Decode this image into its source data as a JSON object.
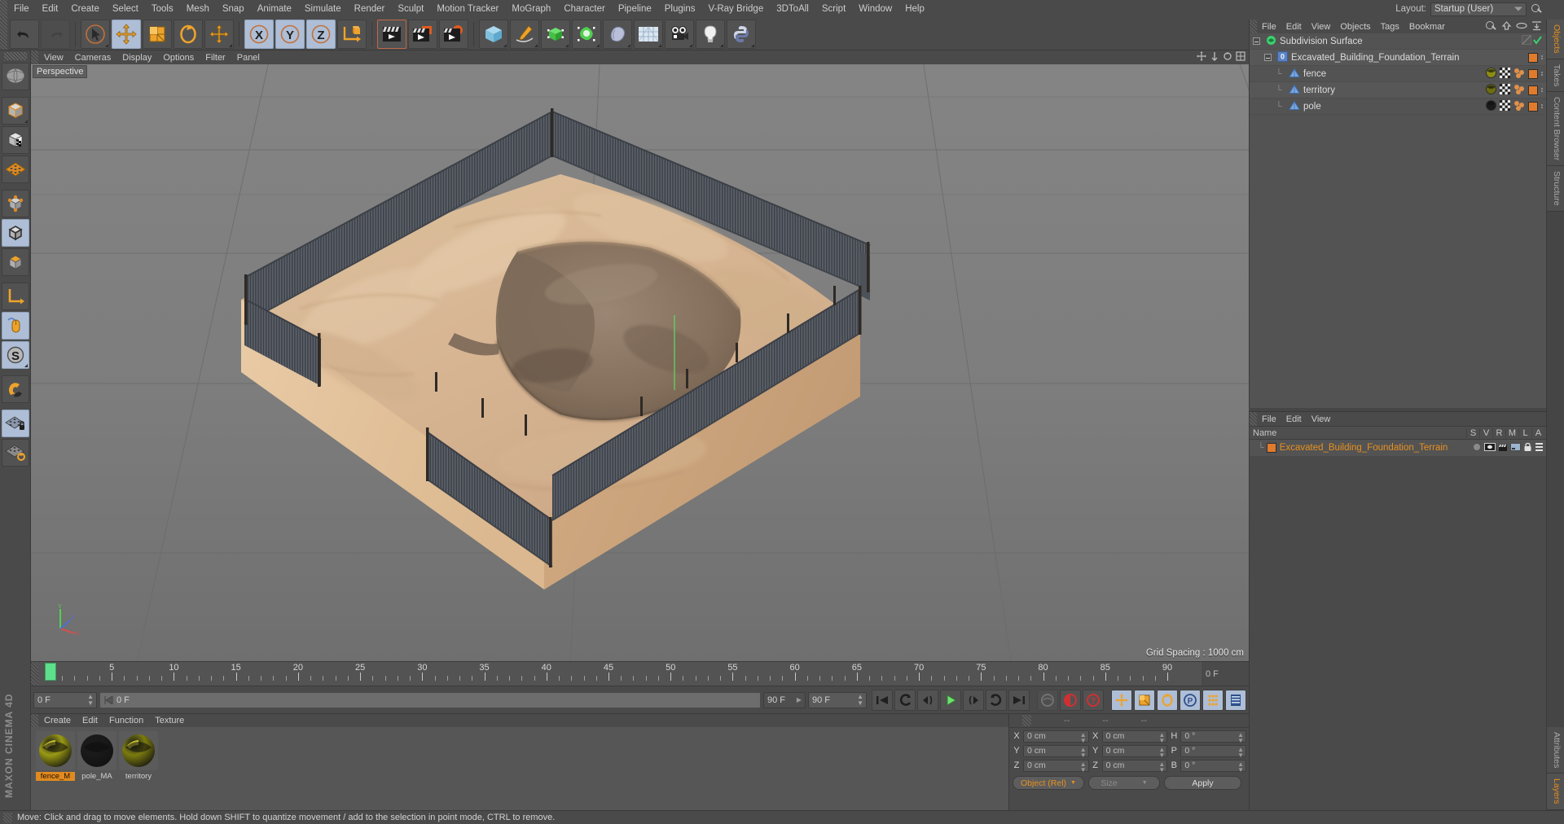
{
  "app": {
    "brand": "MAXON CINEMA 4D"
  },
  "menubar": {
    "items": [
      "File",
      "Edit",
      "Create",
      "Select",
      "Tools",
      "Mesh",
      "Snap",
      "Animate",
      "Simulate",
      "Render",
      "Sculpt",
      "Motion Tracker",
      "MoGraph",
      "Character",
      "Pipeline",
      "Plugins",
      "V-Ray Bridge",
      "3DToAll",
      "Script",
      "Window",
      "Help"
    ],
    "layout_label": "Layout:",
    "layout_value": "Startup (User)",
    "search_icon": "search-icon"
  },
  "toolbar": {
    "groups": [
      {
        "name": "history",
        "buttons": [
          {
            "icon": "undo-icon",
            "state": "normal"
          },
          {
            "icon": "redo-icon",
            "state": "disabled"
          }
        ]
      },
      {
        "name": "tools",
        "buttons": [
          {
            "icon": "select-live-icon",
            "state": "normal"
          },
          {
            "icon": "move-icon",
            "state": "active"
          },
          {
            "icon": "scale-icon",
            "state": "normal"
          },
          {
            "icon": "rotate-icon",
            "state": "normal"
          },
          {
            "icon": "move-dup-icon",
            "state": "normal"
          }
        ]
      },
      {
        "name": "axes",
        "buttons": [
          {
            "icon": "axis-x-icon",
            "state": "active"
          },
          {
            "icon": "axis-y-icon",
            "state": "active"
          },
          {
            "icon": "axis-z-icon",
            "state": "active"
          },
          {
            "icon": "world-object-axis-icon",
            "state": "normal"
          }
        ]
      },
      {
        "name": "render",
        "buttons": [
          {
            "icon": "render-view-icon",
            "state": "selected"
          },
          {
            "icon": "render-region-icon",
            "state": "normal"
          },
          {
            "icon": "render-settings-icon",
            "state": "normal"
          }
        ]
      },
      {
        "name": "objects",
        "buttons": [
          {
            "icon": "cube-primitive-icon",
            "state": "normal"
          },
          {
            "icon": "spline-pen-icon",
            "state": "normal"
          },
          {
            "icon": "generator-icon",
            "state": "normal"
          },
          {
            "icon": "deformer-icon",
            "state": "normal"
          },
          {
            "icon": "scene-environment-icon",
            "state": "normal"
          },
          {
            "icon": "floor-grid-icon",
            "state": "normal"
          },
          {
            "icon": "camera-icon",
            "state": "normal"
          },
          {
            "icon": "light-icon",
            "state": "normal"
          },
          {
            "icon": "python-icon",
            "state": "normal"
          }
        ]
      }
    ]
  },
  "lefttool": {
    "buttons": [
      {
        "icon": "texture-mode-icon",
        "state": "normal"
      },
      {
        "icon": "model-mode-icon",
        "state": "normal"
      },
      {
        "icon": "texture-axis-icon",
        "state": "normal"
      },
      {
        "icon": "workplane-icon",
        "state": "normal"
      },
      {
        "icon": "point-mode-icon",
        "state": "normal"
      },
      {
        "icon": "edge-mode-icon",
        "state": "active"
      },
      {
        "icon": "polygon-mode-icon",
        "state": "normal"
      },
      {
        "icon": "axis-modify-icon",
        "state": "normal"
      },
      {
        "icon": "viewport-solo-icon",
        "state": "active"
      },
      {
        "icon": "enable-axis-s-icon",
        "state": "active"
      },
      {
        "icon": "magnet-icon",
        "state": "normal"
      },
      {
        "icon": "workplane-lock-icon",
        "state": "active"
      },
      {
        "icon": "workplane-rotate-icon",
        "state": "normal"
      }
    ]
  },
  "viewport": {
    "menu": [
      "View",
      "Cameras",
      "Display",
      "Options",
      "Filter",
      "Panel"
    ],
    "label": "Perspective",
    "grid_spacing": "Grid Spacing : 1000 cm",
    "background_color": "#7a7a7a",
    "grid_line_color": "#6b6b6b",
    "terrain_top_color": "#d6b48d",
    "terrain_side_color": "#e3c19b",
    "pit_color": "#8d7a67",
    "fence_color": "#5b5e63",
    "axis_y_color": "#4fd24f",
    "axis_x_color": "#d24f4f",
    "axis_z_color": "#4f6fd2"
  },
  "timeline": {
    "ticks": [
      0,
      5,
      10,
      15,
      20,
      25,
      30,
      35,
      40,
      45,
      50,
      55,
      60,
      65,
      70,
      75,
      80,
      85,
      90
    ],
    "range_start": 0,
    "range_end": 90,
    "playhead_frame": 0,
    "end_value": "0 F"
  },
  "transport": {
    "current_frame": "0 F",
    "slider_value": "0 F",
    "range_end_small": "90 F",
    "range_end": "90 F",
    "buttons": [
      {
        "icon": "goto-start-icon"
      },
      {
        "icon": "prev-key-icon"
      },
      {
        "icon": "step-back-icon"
      },
      {
        "icon": "play-icon"
      },
      {
        "icon": "step-forward-icon"
      },
      {
        "icon": "next-key-icon"
      },
      {
        "icon": "goto-end-icon"
      }
    ],
    "buttons2": [
      {
        "icon": "record-tracks-icon"
      },
      {
        "icon": "record-active-icon"
      },
      {
        "icon": "autokey-icon"
      }
    ],
    "buttons3": [
      {
        "icon": "key-position-icon"
      },
      {
        "icon": "key-scale-icon"
      },
      {
        "icon": "key-rotation-icon"
      },
      {
        "icon": "key-param-icon"
      },
      {
        "icon": "key-pla-icon"
      },
      {
        "icon": "timeline-icon"
      }
    ]
  },
  "material_manager": {
    "menu": [
      "Create",
      "Edit",
      "Function",
      "Texture"
    ],
    "materials": [
      {
        "name": "fence_M",
        "selected": true,
        "color": "#9a9a14"
      },
      {
        "name": "pole_MA",
        "selected": false,
        "color": "#1a1a1a"
      },
      {
        "name": "territory",
        "selected": false,
        "color": "#7b7b10"
      }
    ]
  },
  "coordinates": {
    "headers": [
      "--",
      "--",
      "--"
    ],
    "position": {
      "label_x": "X",
      "label_y": "Y",
      "label_z": "Z",
      "x": "0 cm",
      "y": "0 cm",
      "z": "0 cm"
    },
    "size": {
      "label_x": "X",
      "label_y": "Y",
      "label_z": "Z",
      "x": "0 cm",
      "y": "0 cm",
      "z": "0 cm"
    },
    "rotation": {
      "label_h": "H",
      "label_p": "P",
      "label_b": "B",
      "h": "0 °",
      "p": "0 °",
      "b": "0 °"
    },
    "mode": "Object (Rel)",
    "size_mode": "Size",
    "apply": "Apply"
  },
  "object_manager": {
    "menu": [
      "File",
      "Edit",
      "View",
      "Objects",
      "Tags",
      "Bookmar"
    ],
    "tools": [
      "search-icon",
      "up-arrow-icon",
      "ellipse-icon",
      "collapse-icon"
    ],
    "rows": [
      {
        "name": "Subdivision Surface",
        "depth": 0,
        "icon": "subdivision-surface-icon",
        "has_expander": true,
        "tag_color": null,
        "checkmark": true
      },
      {
        "name": "Excavated_Building_Foundation_Terrain",
        "depth": 1,
        "icon": "null-object-icon",
        "has_expander": true,
        "tag_color": "#e07b2c",
        "checkmark": false
      },
      {
        "name": "fence",
        "depth": 2,
        "icon": "polygon-object-icon",
        "has_expander": false,
        "tag_color": "#e07b2c",
        "checkmark": false,
        "material_color": "#8c8c14",
        "texture": true
      },
      {
        "name": "territory",
        "depth": 2,
        "icon": "polygon-object-icon",
        "has_expander": false,
        "tag_color": "#e07b2c",
        "checkmark": false,
        "material_color": "#6d6d10",
        "texture": true
      },
      {
        "name": "pole",
        "depth": 2,
        "icon": "polygon-object-icon",
        "has_expander": false,
        "tag_color": "#e07b2c",
        "checkmark": false,
        "material_color": "#1b1b1b",
        "texture": true
      }
    ]
  },
  "layer_manager": {
    "menu": [
      "File",
      "Edit",
      "View"
    ],
    "name_header": "Name",
    "columns": [
      "S",
      "V",
      "R",
      "M",
      "L",
      "A"
    ],
    "rows": [
      {
        "name": "Excavated_Building_Foundation_Terrain",
        "color": "#e07b2c"
      }
    ]
  },
  "vertical_tabs_top": [
    "Objects",
    "Takes",
    "Content Browser",
    "Structure"
  ],
  "vertical_tabs_bottom": [
    "Attributes",
    "Layers"
  ],
  "status": {
    "text": "Move: Click and drag to move elements. Hold down SHIFT to quantize movement / add to the selection in point mode, CTRL to remove."
  }
}
